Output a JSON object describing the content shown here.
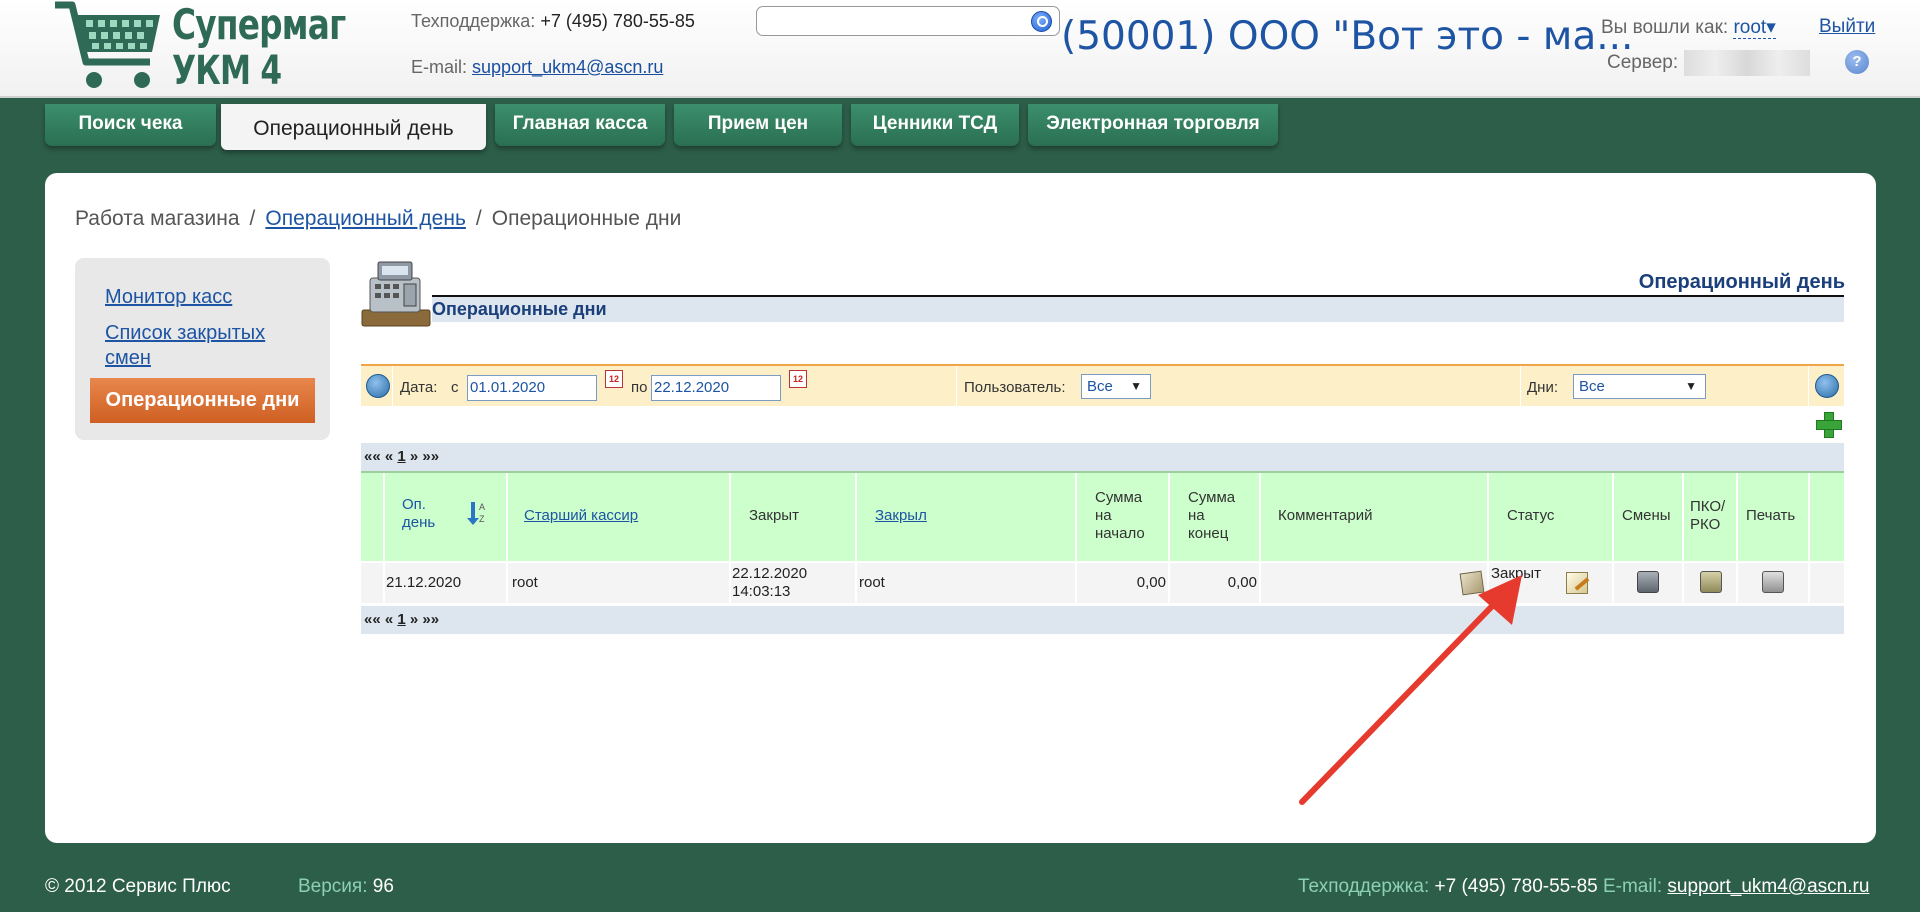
{
  "header": {
    "logo_line1": "Супермаг",
    "logo_line2": "УКМ 4",
    "support_label": "Техподдержка:",
    "support_phone": "+7 (495) 780-55-85",
    "email_label": "E-mail:",
    "email": "support_ukm4@ascn.ru",
    "search_value": "",
    "company_title": "(50001) ООО \"Вот это - ма...",
    "logged_as_label": "Вы вошли как:",
    "username": "root",
    "logout_label": "Выйти",
    "server_label": "Сервер:",
    "help_label": "?"
  },
  "tabs": [
    {
      "label": "Поиск чека",
      "active": false
    },
    {
      "label": "Операционный день",
      "active": true
    },
    {
      "label": "Главная касса",
      "active": false
    },
    {
      "label": "Прием цен",
      "active": false
    },
    {
      "label": "Ценники ТСД",
      "active": false
    },
    {
      "label": "Электронная торговля",
      "active": false
    }
  ],
  "breadcrumb": {
    "root": "Работа магазина",
    "link": "Операционный день",
    "current": "Операционные дни",
    "separator": "/"
  },
  "sidebar": {
    "items": [
      {
        "label": "Монитор касс"
      },
      {
        "label": "Список закрытых"
      },
      {
        "label": "смен"
      },
      {
        "label": "Операционные дни",
        "active": true
      }
    ]
  },
  "section": {
    "title_right": "Операционный день",
    "title_bar": "Операционные дни"
  },
  "filters": {
    "date_label": "Дата:",
    "from_label": "с",
    "from_value": "01.01.2020",
    "to_label": "по",
    "to_value": "22.12.2020",
    "calendar_icon_text": "12",
    "user_label": "Пользователь:",
    "user_value": "Все",
    "days_label": "Дни:",
    "days_value": "Все"
  },
  "pager": {
    "first": "««",
    "prev": "«",
    "page": "1",
    "next": "»",
    "last": "»»"
  },
  "table": {
    "columns": {
      "opday_line1": "Оп.",
      "opday_line2": "день",
      "senior_cashier": "Старший кассир",
      "closed": "Закрыт",
      "closed_by": "Закрыл",
      "sum_start_1": "Сумма",
      "sum_start_2": "на",
      "sum_start_3": "начало",
      "sum_end_1": "Сумма",
      "sum_end_2": "на",
      "sum_end_3": "конец",
      "comment": "Комментарий",
      "status": "Статус",
      "shifts": "Смены",
      "pko_1": "ПКО/",
      "pko_2": "РКО",
      "print": "Печать"
    },
    "rows": [
      {
        "opday": "21.12.2020",
        "senior_cashier": "root",
        "closed_date": "22.12.2020",
        "closed_time": "14:03:13",
        "closed_by": "root",
        "sum_start": "0,00",
        "sum_end": "0,00",
        "comment": "",
        "status": "Закрыт"
      }
    ]
  },
  "footer": {
    "copyright": "© 2012 Сервис Плюс",
    "version_label": "Версия:",
    "version": "96",
    "support_label": "Техподдержка:",
    "support_phone": "+7 (495) 780-55-85",
    "email_label": "E-mail:",
    "email": "support_ukm4@ascn.ru"
  },
  "colors": {
    "background": "#2d5e4a",
    "tab": "#2b6f53",
    "link": "#1d54a3",
    "active_menu": "#d9692a",
    "table_header": "#ccffcc",
    "filter_bar": "#fdf0c9",
    "arrow": "#e63a2e"
  }
}
